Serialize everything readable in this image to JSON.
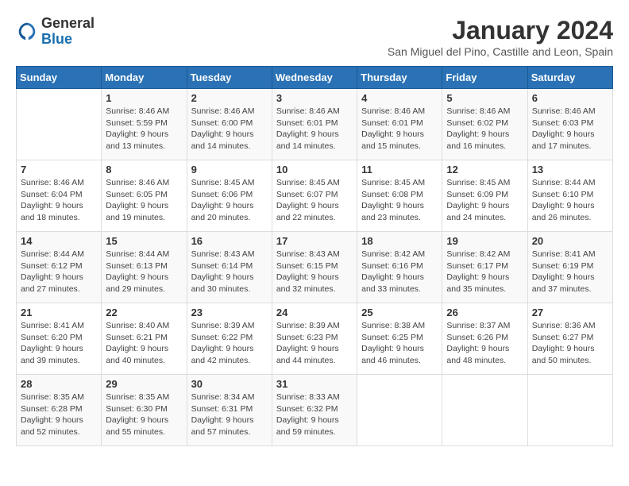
{
  "header": {
    "logo_general": "General",
    "logo_blue": "Blue",
    "month_year": "January 2024",
    "location": "San Miguel del Pino, Castille and Leon, Spain"
  },
  "weekdays": [
    "Sunday",
    "Monday",
    "Tuesday",
    "Wednesday",
    "Thursday",
    "Friday",
    "Saturday"
  ],
  "weeks": [
    [
      {
        "day": "",
        "detail": ""
      },
      {
        "day": "1",
        "detail": "Sunrise: 8:46 AM\nSunset: 5:59 PM\nDaylight: 9 hours\nand 13 minutes."
      },
      {
        "day": "2",
        "detail": "Sunrise: 8:46 AM\nSunset: 6:00 PM\nDaylight: 9 hours\nand 14 minutes."
      },
      {
        "day": "3",
        "detail": "Sunrise: 8:46 AM\nSunset: 6:01 PM\nDaylight: 9 hours\nand 14 minutes."
      },
      {
        "day": "4",
        "detail": "Sunrise: 8:46 AM\nSunset: 6:01 PM\nDaylight: 9 hours\nand 15 minutes."
      },
      {
        "day": "5",
        "detail": "Sunrise: 8:46 AM\nSunset: 6:02 PM\nDaylight: 9 hours\nand 16 minutes."
      },
      {
        "day": "6",
        "detail": "Sunrise: 8:46 AM\nSunset: 6:03 PM\nDaylight: 9 hours\nand 17 minutes."
      }
    ],
    [
      {
        "day": "7",
        "detail": "Sunrise: 8:46 AM\nSunset: 6:04 PM\nDaylight: 9 hours\nand 18 minutes."
      },
      {
        "day": "8",
        "detail": "Sunrise: 8:46 AM\nSunset: 6:05 PM\nDaylight: 9 hours\nand 19 minutes."
      },
      {
        "day": "9",
        "detail": "Sunrise: 8:45 AM\nSunset: 6:06 PM\nDaylight: 9 hours\nand 20 minutes."
      },
      {
        "day": "10",
        "detail": "Sunrise: 8:45 AM\nSunset: 6:07 PM\nDaylight: 9 hours\nand 22 minutes."
      },
      {
        "day": "11",
        "detail": "Sunrise: 8:45 AM\nSunset: 6:08 PM\nDaylight: 9 hours\nand 23 minutes."
      },
      {
        "day": "12",
        "detail": "Sunrise: 8:45 AM\nSunset: 6:09 PM\nDaylight: 9 hours\nand 24 minutes."
      },
      {
        "day": "13",
        "detail": "Sunrise: 8:44 AM\nSunset: 6:10 PM\nDaylight: 9 hours\nand 26 minutes."
      }
    ],
    [
      {
        "day": "14",
        "detail": "Sunrise: 8:44 AM\nSunset: 6:12 PM\nDaylight: 9 hours\nand 27 minutes."
      },
      {
        "day": "15",
        "detail": "Sunrise: 8:44 AM\nSunset: 6:13 PM\nDaylight: 9 hours\nand 29 minutes."
      },
      {
        "day": "16",
        "detail": "Sunrise: 8:43 AM\nSunset: 6:14 PM\nDaylight: 9 hours\nand 30 minutes."
      },
      {
        "day": "17",
        "detail": "Sunrise: 8:43 AM\nSunset: 6:15 PM\nDaylight: 9 hours\nand 32 minutes."
      },
      {
        "day": "18",
        "detail": "Sunrise: 8:42 AM\nSunset: 6:16 PM\nDaylight: 9 hours\nand 33 minutes."
      },
      {
        "day": "19",
        "detail": "Sunrise: 8:42 AM\nSunset: 6:17 PM\nDaylight: 9 hours\nand 35 minutes."
      },
      {
        "day": "20",
        "detail": "Sunrise: 8:41 AM\nSunset: 6:19 PM\nDaylight: 9 hours\nand 37 minutes."
      }
    ],
    [
      {
        "day": "21",
        "detail": "Sunrise: 8:41 AM\nSunset: 6:20 PM\nDaylight: 9 hours\nand 39 minutes."
      },
      {
        "day": "22",
        "detail": "Sunrise: 8:40 AM\nSunset: 6:21 PM\nDaylight: 9 hours\nand 40 minutes."
      },
      {
        "day": "23",
        "detail": "Sunrise: 8:39 AM\nSunset: 6:22 PM\nDaylight: 9 hours\nand 42 minutes."
      },
      {
        "day": "24",
        "detail": "Sunrise: 8:39 AM\nSunset: 6:23 PM\nDaylight: 9 hours\nand 44 minutes."
      },
      {
        "day": "25",
        "detail": "Sunrise: 8:38 AM\nSunset: 6:25 PM\nDaylight: 9 hours\nand 46 minutes."
      },
      {
        "day": "26",
        "detail": "Sunrise: 8:37 AM\nSunset: 6:26 PM\nDaylight: 9 hours\nand 48 minutes."
      },
      {
        "day": "27",
        "detail": "Sunrise: 8:36 AM\nSunset: 6:27 PM\nDaylight: 9 hours\nand 50 minutes."
      }
    ],
    [
      {
        "day": "28",
        "detail": "Sunrise: 8:35 AM\nSunset: 6:28 PM\nDaylight: 9 hours\nand 52 minutes."
      },
      {
        "day": "29",
        "detail": "Sunrise: 8:35 AM\nSunset: 6:30 PM\nDaylight: 9 hours\nand 55 minutes."
      },
      {
        "day": "30",
        "detail": "Sunrise: 8:34 AM\nSunset: 6:31 PM\nDaylight: 9 hours\nand 57 minutes."
      },
      {
        "day": "31",
        "detail": "Sunrise: 8:33 AM\nSunset: 6:32 PM\nDaylight: 9 hours\nand 59 minutes."
      },
      {
        "day": "",
        "detail": ""
      },
      {
        "day": "",
        "detail": ""
      },
      {
        "day": "",
        "detail": ""
      }
    ]
  ]
}
